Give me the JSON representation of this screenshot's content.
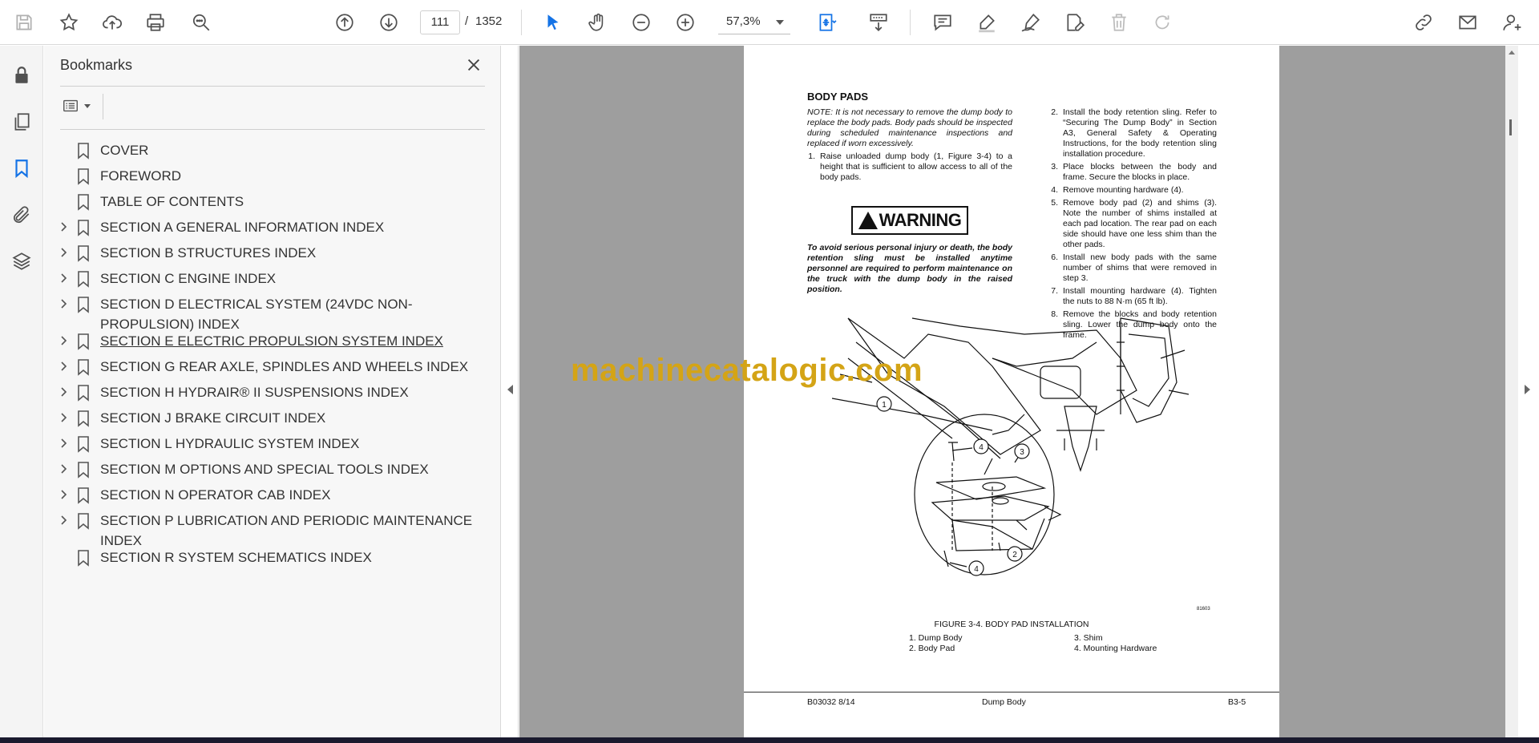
{
  "toolbar": {
    "page_current": "111",
    "page_separator": "/",
    "page_total": "1352",
    "zoom": "57,3%"
  },
  "bookmarks": {
    "title": "Bookmarks",
    "items": [
      {
        "label": "COVER",
        "expandable": false
      },
      {
        "label": "FOREWORD",
        "expandable": false
      },
      {
        "label": "TABLE OF CONTENTS",
        "expandable": false
      },
      {
        "label": "SECTION A GENERAL INFORMATION INDEX",
        "expandable": true
      },
      {
        "label": "SECTION B STRUCTURES INDEX",
        "expandable": true
      },
      {
        "label": "SECTION C ENGINE INDEX",
        "expandable": true
      },
      {
        "label": "SECTION D ELECTRICAL SYSTEM (24VDC NON-PROPULSION) INDEX",
        "expandable": true
      },
      {
        "label": "SECTION E ELECTRIC PROPULSION SYSTEM INDEX",
        "expandable": true
      },
      {
        "label": "SECTION G REAR AXLE, SPINDLES AND WHEELS INDEX",
        "expandable": true
      },
      {
        "label": "SECTION H HYDRAIR® II SUSPENSIONS INDEX",
        "expandable": true
      },
      {
        "label": "SECTION J BRAKE CIRCUIT INDEX",
        "expandable": true
      },
      {
        "label": "SECTION L HYDRAULIC SYSTEM INDEX",
        "expandable": true
      },
      {
        "label": "SECTION M OPTIONS AND SPECIAL TOOLS INDEX",
        "expandable": true
      },
      {
        "label": "SECTION N OPERATOR CAB INDEX",
        "expandable": true
      },
      {
        "label": "SECTION P LUBRICATION AND PERIODIC MAINTENANCE INDEX",
        "expandable": true
      },
      {
        "label": "SECTION R SYSTEM SCHEMATICS INDEX",
        "expandable": false
      }
    ]
  },
  "document": {
    "heading": "BODY PADS",
    "note": "NOTE: It is not necessary to remove the dump body to replace the body pads. Body pads should be inspected during scheduled maintenance inspections and replaced if worn excessively.",
    "step1_num": "1.",
    "step1": "Raise unloaded dump body (1, Figure 3-4) to a height that is sufficient to allow access to all of the body pads.",
    "warning_label": "WARNING",
    "warning_text": "To avoid serious personal injury or death, the body retention sling must be installed anytime personnel are required to perform maintenance on the truck with the dump body in the raised position.",
    "steps_right": [
      {
        "n": "2.",
        "t": "Install the body retention sling. Refer to “Securing The Dump Body” in Section A3, General Safety & Operating Instructions, for the body retention sling installation procedure."
      },
      {
        "n": "3.",
        "t": "Place blocks between the body and frame. Secure the blocks in place."
      },
      {
        "n": "4.",
        "t": "Remove mounting hardware (4)."
      },
      {
        "n": "5.",
        "t": "Remove body pad (2) and shims (3). Note the number of shims installed at each pad location. The rear pad on each side should have one less shim than the other pads."
      },
      {
        "n": "6.",
        "t": "Install new body pads with the same number of shims that were removed in step 3."
      },
      {
        "n": "7.",
        "t": "Install mounting hardware (4). Tighten the nuts to 88 N·m (65 ft lb)."
      },
      {
        "n": "8.",
        "t": "Remove the blocks and body retention sling. Lower the dump body onto the frame."
      }
    ],
    "figure_caption": "FIGURE 3-4. BODY PAD INSTALLATION",
    "figure_code": "81603",
    "callouts": [
      "1",
      "2",
      "3",
      "4",
      "4"
    ],
    "legend": [
      "1. Dump Body",
      "2. Body Pad",
      "3. Shim",
      "4. Mounting Hardware"
    ],
    "footer_left": "B03032   8/14",
    "footer_center": "Dump Body",
    "footer_right": "B3-5"
  },
  "watermark": "machinecatalogic.com"
}
